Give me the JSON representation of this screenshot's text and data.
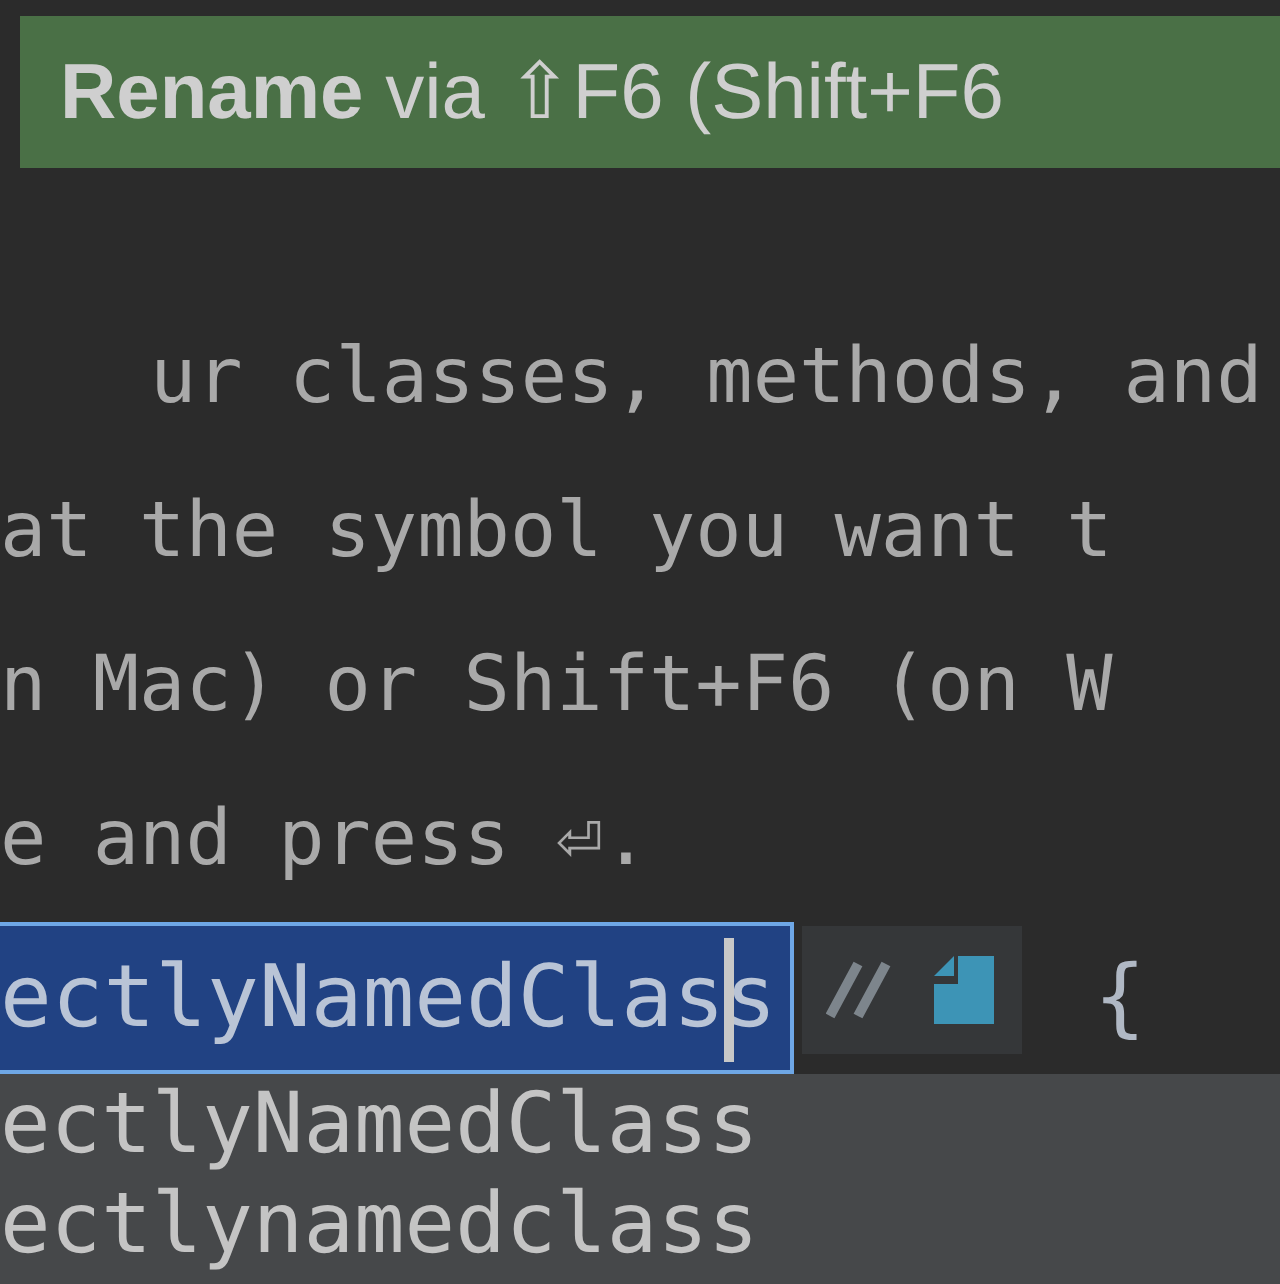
{
  "tooltip": {
    "text": "**Rename** via ⇧F6 (Shift+F6"
  },
  "description_lines": [
    "ur classes, methods, and",
    "at the symbol you want t",
    "n Mac) or Shift+F6 (on W",
    "e and press ⏎."
  ],
  "editor": {
    "rename_field": {
      "value": "ectlyNamedClass"
    },
    "brace": "{"
  },
  "suggestions": [
    {
      "label": "ectlyNamedClass"
    },
    {
      "label": "ectlynamedclass"
    }
  ]
}
